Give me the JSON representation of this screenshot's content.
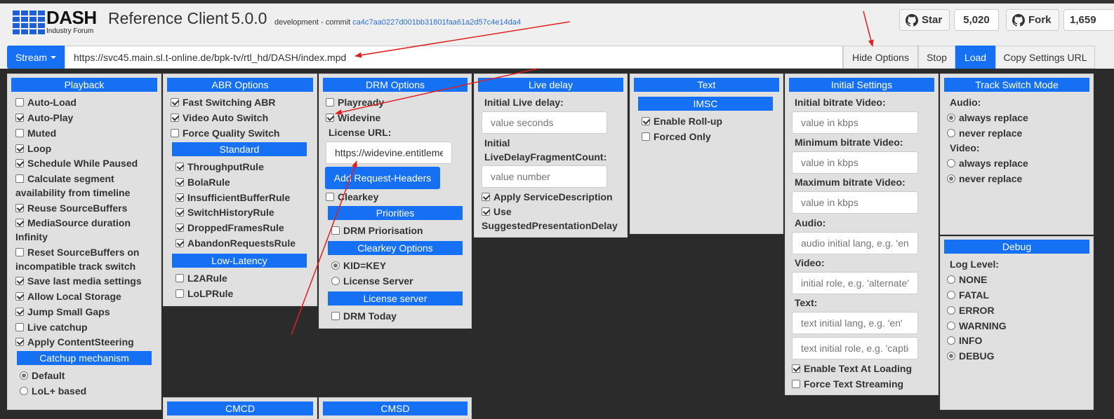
{
  "header": {
    "logo_text": "DASH",
    "logo_subtext": "Industry Forum",
    "title": "Reference Client",
    "version": "5.0.0",
    "commit_prefix": "development - commit",
    "commit_hash": "ca4c7aa0227d001bb31801faa61a2d57c4e14da4",
    "star_label": "Star",
    "star_count": "5,020",
    "fork_label": "Fork",
    "fork_count": "1,659"
  },
  "toolbar": {
    "stream_label": "Stream",
    "url_value": "https://svc45.main.sl.t-online.de/bpk-tv/rtl_hd/DASH/index.mpd",
    "hide_options": "Hide Options",
    "stop": "Stop",
    "load": "Load",
    "copy_settings": "Copy Settings URL"
  },
  "playback": {
    "title": "Playback",
    "items": [
      {
        "label": "Auto-Load",
        "checked": false
      },
      {
        "label": "Auto-Play",
        "checked": true
      },
      {
        "label": "Muted",
        "checked": false
      },
      {
        "label": "Loop",
        "checked": true
      },
      {
        "label": "Schedule While Paused",
        "checked": true
      },
      {
        "label": "Calculate segment availability from timeline",
        "checked": false
      },
      {
        "label": "Reuse SourceBuffers",
        "checked": true
      },
      {
        "label": "MediaSource duration Infinity",
        "checked": true
      },
      {
        "label": "Reset SourceBuffers on incompatible track switch",
        "checked": false
      },
      {
        "label": "Save last media settings",
        "checked": true
      },
      {
        "label": "Allow Local Storage",
        "checked": true
      },
      {
        "label": "Jump Small Gaps",
        "checked": true
      },
      {
        "label": "Live catchup",
        "checked": false
      },
      {
        "label": "Apply ContentSteering",
        "checked": true
      }
    ],
    "catchup_title": "Catchup mechanism",
    "catchup_options": [
      {
        "label": "Default",
        "selected": true
      },
      {
        "label": "LoL+ based",
        "selected": false
      }
    ]
  },
  "abr": {
    "title": "ABR Options",
    "items": [
      {
        "label": "Fast Switching ABR",
        "checked": true
      },
      {
        "label": "Video Auto Switch",
        "checked": true
      },
      {
        "label": "Force Quality Switch",
        "checked": false
      }
    ],
    "standard_title": "Standard",
    "standard_rules": [
      {
        "label": "ThroughputRule",
        "checked": true
      },
      {
        "label": "BolaRule",
        "checked": true
      },
      {
        "label": "InsufficientBufferRule",
        "checked": true
      },
      {
        "label": "SwitchHistoryRule",
        "checked": true
      },
      {
        "label": "DroppedFramesRule",
        "checked": true
      },
      {
        "label": "AbandonRequestsRule",
        "checked": true
      }
    ],
    "lowlatency_title": "Low-Latency",
    "lowlatency_rules": [
      {
        "label": "L2ARule",
        "checked": false
      },
      {
        "label": "LoLPRule",
        "checked": false
      }
    ],
    "cmcd_title": "CMCD"
  },
  "drm": {
    "title": "DRM Options",
    "playready": "Playready",
    "widevine": "Widevine",
    "license_url_label": "License URL:",
    "license_url_value": "https://widevine.entitleme",
    "add_headers": "Add Request-Headers",
    "clearkey": "Clearkey",
    "priorities_title": "Priorities",
    "drm_priorisation": "DRM Priorisation",
    "clearkey_options_title": "Clearkey Options",
    "kid_key": "KID=KEY",
    "license_server": "License Server",
    "license_server_title": "License server",
    "drm_today": "DRM Today",
    "cmsd_title": "CMSD"
  },
  "live_delay": {
    "title": "Live delay",
    "initial_label": "Initial Live delay:",
    "initial_placeholder": "value seconds",
    "fragment_label": "Initial LiveDelayFragmentCount:",
    "fragment_placeholder": "value number",
    "apply_service_description": "Apply ServiceDescription",
    "use_suggested": "Use SuggestedPresentationDelay"
  },
  "text": {
    "title": "Text",
    "imsc_title": "IMSC",
    "enable_rollup": "Enable Roll-up",
    "forced_only": "Forced Only"
  },
  "initial": {
    "title": "Initial Settings",
    "fields": [
      {
        "label": "Initial bitrate Video:",
        "placeholder": "value in kbps"
      },
      {
        "label": "Minimum bitrate Video:",
        "placeholder": "value in kbps"
      },
      {
        "label": "Maximum bitrate Video:",
        "placeholder": "value in kbps"
      },
      {
        "label": "Audio:",
        "placeholder": "audio initial lang, e.g. 'en'"
      },
      {
        "label": "Video:",
        "placeholder": "initial role, e.g. 'alternate'"
      },
      {
        "label": "Text:",
        "placeholder": "text initial lang, e.g. 'en'"
      }
    ],
    "text_role_placeholder": "text initial role, e.g. 'caption'",
    "enable_text_loading": "Enable Text At Loading",
    "force_text_streaming": "Force Text Streaming"
  },
  "track_switch": {
    "title": "Track Switch Mode",
    "audio_label": "Audio:",
    "video_label": "Video:",
    "always_replace": "always replace",
    "never_replace": "never replace"
  },
  "debug": {
    "title": "Debug",
    "log_level_label": "Log Level:",
    "levels": [
      "NONE",
      "FATAL",
      "ERROR",
      "WARNING",
      "INFO",
      "DEBUG"
    ],
    "selected_level": "DEBUG"
  },
  "colors": {
    "accent": "#1670f3",
    "annotation_arrow": "#e02020",
    "panel_bg": "#e0e0e0",
    "page_bg": "#2b2b2b"
  }
}
